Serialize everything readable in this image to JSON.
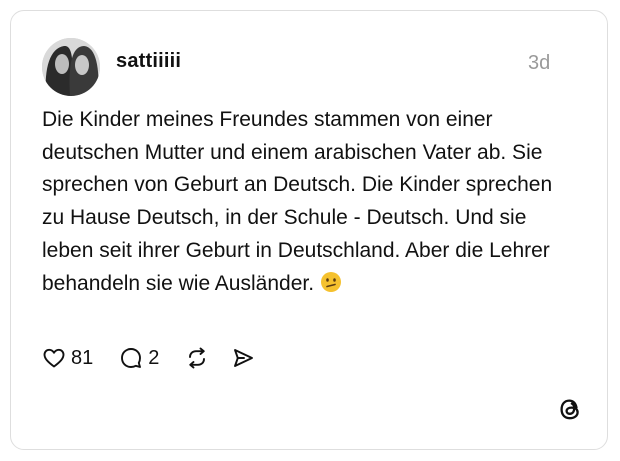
{
  "post": {
    "username": "sattiiiii",
    "timestamp": "3d",
    "text": "Die Kinder meines Freundes stammen von einer deutschen Mutter und einem arabischen Vater ab. Sie sprechen von Geburt an Deutsch. Die Kinder sprechen zu Hause Deutsch, in der Schule - Deutsch. Und sie leben seit ihrer Geburt in Deutschland. Aber die Lehrer behandeln sie wie Ausländer.",
    "emoji": "confused-face-emoji"
  },
  "actions": {
    "like_count": "81",
    "comment_count": "2",
    "icons": [
      "heart-icon",
      "comment-icon",
      "repost-icon",
      "share-icon"
    ]
  },
  "brand": {
    "logo": "threads-logo-icon"
  },
  "colors": {
    "text": "#111111",
    "muted": "#9a9a9a",
    "border": "#dedede",
    "emoji": "#f5c12e"
  }
}
